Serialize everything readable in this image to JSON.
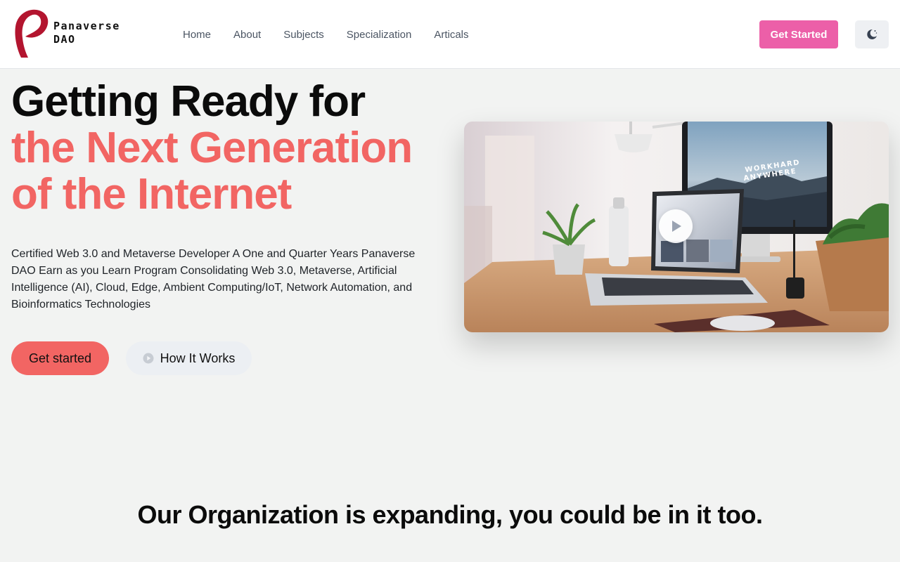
{
  "brand": {
    "name_line1": "Panaverse",
    "name_line2": "DAO",
    "accent_color": "#b3152f"
  },
  "nav": {
    "items": [
      {
        "label": "Home"
      },
      {
        "label": "About"
      },
      {
        "label": "Subjects"
      },
      {
        "label": "Specialization"
      },
      {
        "label": "Articals"
      }
    ]
  },
  "header": {
    "cta_label": "Get Started",
    "cta_color": "#ec5fa8",
    "theme_toggle_icon": "moon-icon"
  },
  "hero": {
    "title_line1": "Getting Ready for",
    "title_line2": "the Next Generation",
    "title_line3": "of the Internet",
    "highlight_color": "#f26563",
    "description": "Certified Web 3.0 and Metaverse Developer A One and Quarter Years Panaverse DAO Earn as you Learn Program Consolidating Web 3.0, Metaverse, Artificial Intelligence (AI), Cloud, Edge, Ambient Computing/IoT, Network Automation, and Bioinformatics Technologies",
    "primary_button": "Get started",
    "secondary_button": "How It Works",
    "secondary_icon": "play-circle-icon",
    "video_play_icon": "play-icon",
    "monitor_text_1": "WORKHARD",
    "monitor_text_2": "ANYWHERE"
  },
  "section": {
    "title": "Our Organization is expanding, you could be in it too."
  }
}
